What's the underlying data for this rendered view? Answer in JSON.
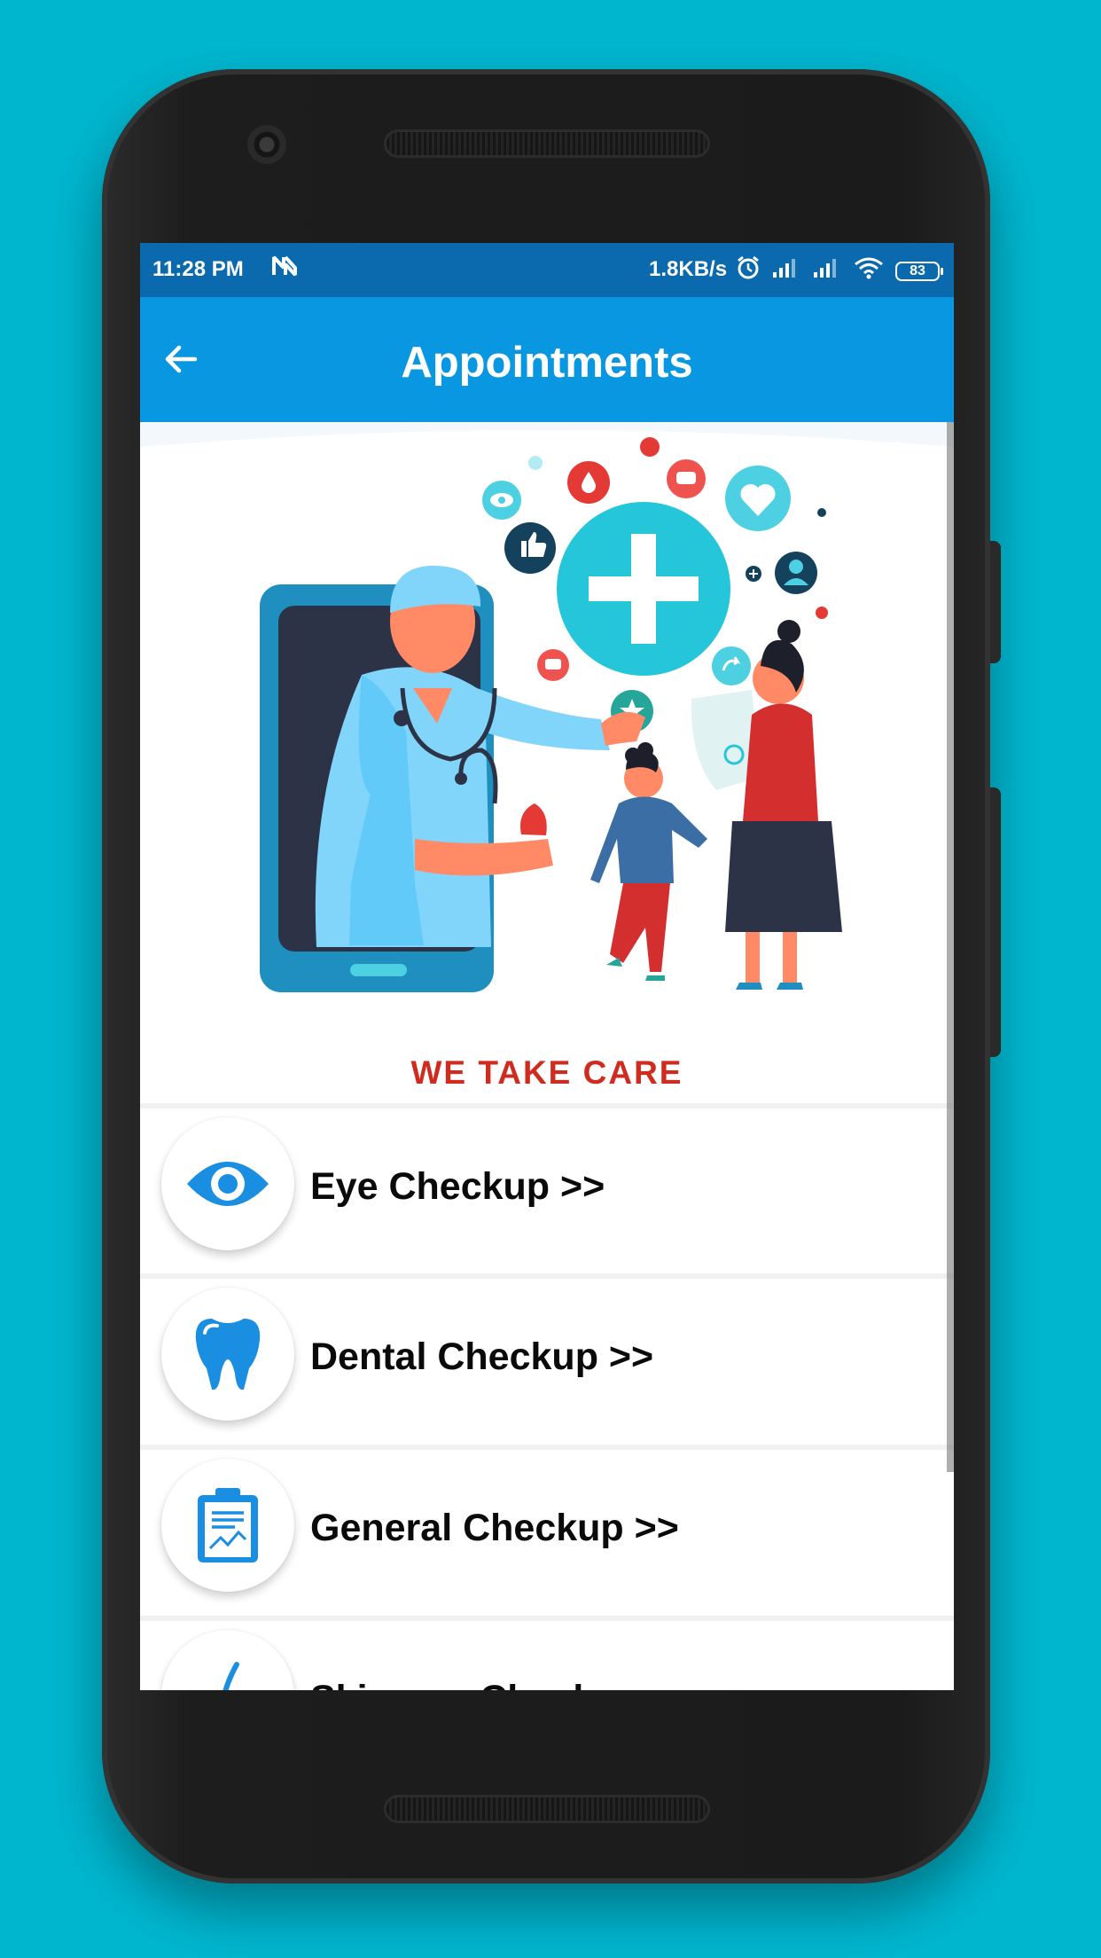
{
  "colors": {
    "background": "#00b6cf",
    "status_bar": "#0a6aad",
    "app_bar": "#0a97e2",
    "accent_icon": "#1a8ee0",
    "tagline": "#cf2b1e"
  },
  "status_bar": {
    "time": "11:28 PM",
    "network_speed": "1.8KB/s",
    "battery": "83",
    "icons": [
      "n-icon",
      "alarm-icon",
      "signal-icon",
      "signal-icon",
      "wifi-icon",
      "battery-icon"
    ]
  },
  "app_bar": {
    "title": "Appointments",
    "back_icon": "arrow-left-icon"
  },
  "hero": {
    "tagline": "WE TAKE CARE"
  },
  "menu": [
    {
      "label": "Eye Checkup  >>",
      "icon": "eye-icon"
    },
    {
      "label": "Dental Checkup  >>",
      "icon": "tooth-icon"
    },
    {
      "label": "General Checkup  >>",
      "icon": "clipboard-icon"
    },
    {
      "label": "Skincare Checkup",
      "icon": "skincare-icon"
    }
  ]
}
